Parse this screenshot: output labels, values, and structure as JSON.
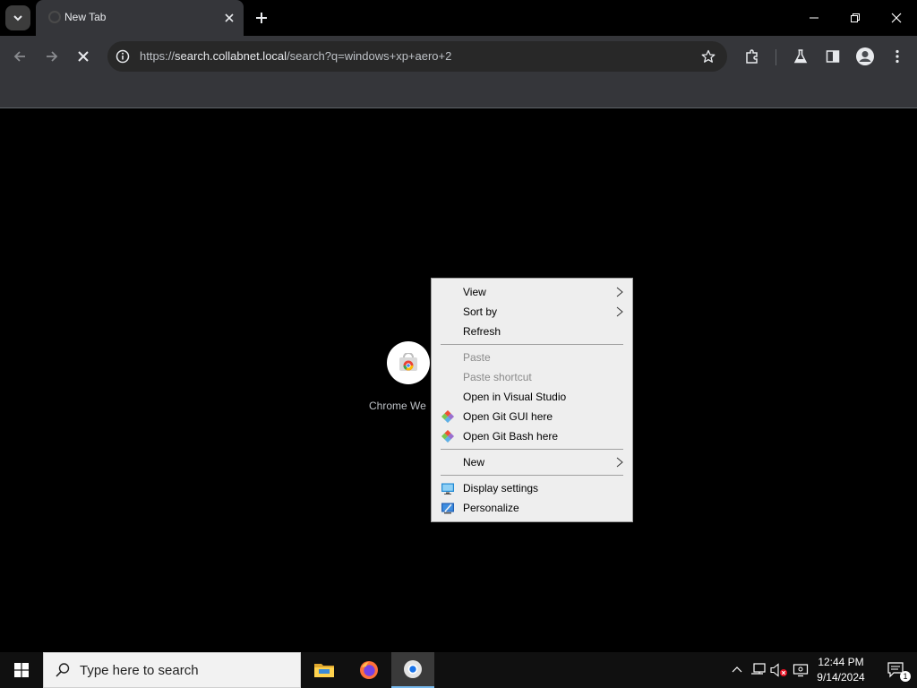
{
  "browser": {
    "tab_title": "New Tab",
    "url_scheme": "https://",
    "url_host": "search.collabnet.local",
    "url_path": "/search?q=windows+xp+aero+2"
  },
  "shortcut": {
    "label": "Chrome We"
  },
  "context_menu": {
    "items": [
      {
        "label": "View",
        "submenu": true,
        "enabled": true
      },
      {
        "label": "Sort by",
        "submenu": true,
        "enabled": true
      },
      {
        "label": "Refresh",
        "enabled": true
      },
      {
        "label": "Paste",
        "enabled": false
      },
      {
        "label": "Paste shortcut",
        "enabled": false
      },
      {
        "label": "Open in Visual Studio",
        "enabled": true
      },
      {
        "label": "Open Git GUI here",
        "enabled": true,
        "icon": "git-icon"
      },
      {
        "label": "Open Git Bash here",
        "enabled": true,
        "icon": "git-icon"
      },
      {
        "label": "New",
        "submenu": true,
        "enabled": true
      },
      {
        "label": "Display settings",
        "enabled": true,
        "icon": "display-icon"
      },
      {
        "label": "Personalize",
        "enabled": true,
        "icon": "personalize-icon"
      }
    ]
  },
  "taskbar": {
    "search_placeholder": "Type here to search",
    "time": "12:44 PM",
    "date": "9/14/2024",
    "notification_count": "1"
  },
  "colors": {
    "accent": "#76b9ed",
    "menu_bg": "#eeeeee",
    "toolbar_bg": "#35363a"
  }
}
